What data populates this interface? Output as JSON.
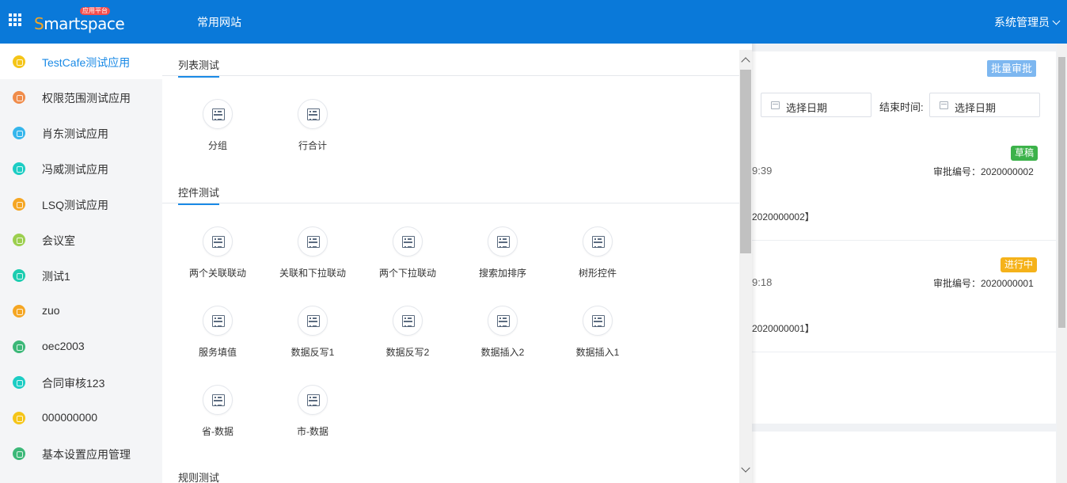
{
  "header": {
    "logo_text": "Smartspace",
    "logo_badge": "应用平台",
    "nav_link": "常用网站",
    "user_name": "系统管理员"
  },
  "sidebar": {
    "items": [
      {
        "label": "TestCafe测试应用",
        "color": "#f5c518",
        "active": true
      },
      {
        "label": "权限范围测试应用",
        "color": "#f08c4a"
      },
      {
        "label": "肖东测试应用",
        "color": "#35b6ec"
      },
      {
        "label": "冯威测试应用",
        "color": "#1ccdc4"
      },
      {
        "label": "LSQ测试应用",
        "color": "#f5a623"
      },
      {
        "label": "会议室",
        "color": "#9ccf4f"
      },
      {
        "label": "测试1",
        "color": "#1ccdb0"
      },
      {
        "label": "zuo",
        "color": "#f5a623"
      },
      {
        "label": "oec2003",
        "color": "#3cb878"
      },
      {
        "label": "合同审核123",
        "color": "#1ccdc4"
      },
      {
        "label": "000000000",
        "color": "#f5c518"
      },
      {
        "label": "基本设置应用管理",
        "color": "#3cb878"
      }
    ]
  },
  "panel": {
    "sections": [
      {
        "title": "列表测试",
        "tiles": [
          "分组",
          "行合计"
        ]
      },
      {
        "title": "控件测试",
        "tiles": [
          "两个关联联动",
          "关联和下拉联动",
          "两个下拉联动",
          "搜索加排序",
          "树形控件",
          "服务填值",
          "数据反写1",
          "数据反写2",
          "数据插入2",
          "数据插入1",
          "省-数据",
          "市-数据"
        ]
      },
      {
        "title": "规则测试",
        "tiles": []
      }
    ]
  },
  "background": {
    "batch_button": "批量审批",
    "start_date_placeholder": "选择日期",
    "end_time_label": "结束时间:",
    "end_date_placeholder": "选择日期",
    "start_label_fragment": ":",
    "records": [
      {
        "status": "草稿",
        "status_color": "#3cb24a",
        "time_fragment": "9:39",
        "approval_no": "审批编号：2020000002",
        "ref_fragment": "2020000002】"
      },
      {
        "status": "进行中",
        "status_color": "#f5b21a",
        "time_fragment": "9:18",
        "approval_no": "审批编号：2020000001",
        "ref_fragment": "2020000001】"
      }
    ]
  }
}
